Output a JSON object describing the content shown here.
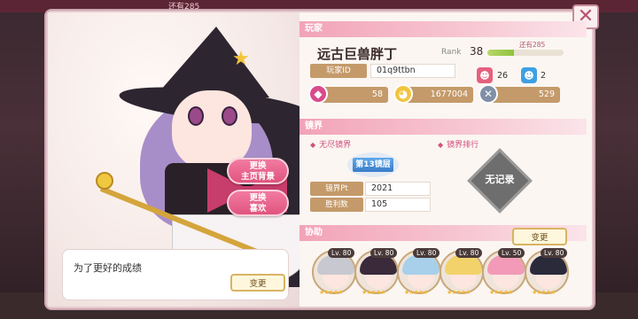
{
  "background_label": "还有285",
  "player_section": {
    "title": "玩家",
    "name": "远古巨兽胖丁",
    "rank_label": "Rank",
    "rank": "38",
    "rank_remaining": "还有285",
    "rank_progress": 0.35,
    "id_label": "玩家ID",
    "id_value": "01q9ttbn",
    "stat_a": "26",
    "stat_b": "2",
    "gems": "58",
    "coins": "1677004",
    "items": "529"
  },
  "portrait": {
    "btn_change_bg_line1": "更换",
    "btn_change_bg_line2": "主页背景",
    "btn_change_fav_line1": "更换",
    "btn_change_fav_line2": "喜欢"
  },
  "comment": {
    "text": "为了更好的成绩",
    "change_label": "变更"
  },
  "mirror_section": {
    "title": "镜界",
    "endless_label": "无尽镜界",
    "ranking_label": "镜界排行",
    "floor_badge": "第13镜层",
    "pt_label": "镜界Pt",
    "pt_value": "2021",
    "wins_label": "胜利数",
    "wins_value": "105",
    "no_record": "无记录"
  },
  "support_section": {
    "title": "协助",
    "change_label": "变更",
    "characters": [
      {
        "level": "Lv. 80",
        "stars": "★★★★★",
        "hair": "#c8c8d0"
      },
      {
        "level": "Lv. 80",
        "stars": "★★★★★",
        "hair": "#3a2a3a"
      },
      {
        "level": "Lv. 80",
        "stars": "★★★★★",
        "hair": "#a8d0ea"
      },
      {
        "level": "Lv. 80",
        "stars": "★★★★★",
        "hair": "#f2d26a"
      },
      {
        "level": "Lv. 50",
        "stars": "★★★★★",
        "hair": "#f29ab8"
      },
      {
        "level": "Lv. 80",
        "stars": "★★★★★",
        "hair": "#2a2a3a"
      }
    ]
  },
  "colors": {
    "section_pink": "#f2a3b8",
    "label_brown": "#c49a6a",
    "button_pink": "#e0557f",
    "floor_blue": "#3a7cc8"
  }
}
